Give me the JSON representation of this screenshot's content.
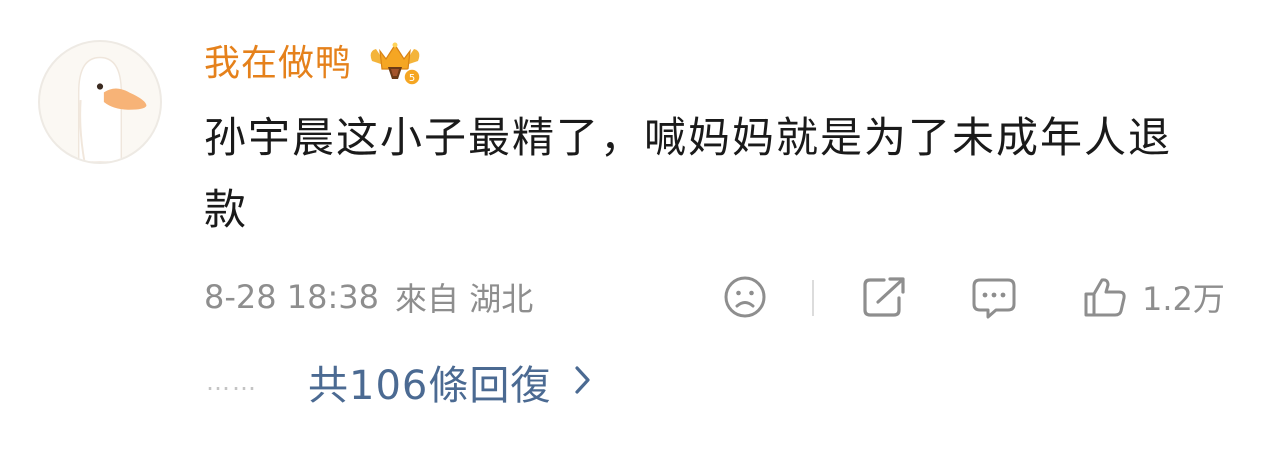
{
  "comment": {
    "username": "我在做鸭",
    "avatar_icon": "goose-avatar-icon",
    "badge_icon": "crown-badge-icon",
    "content": "孙宇晨这小子最精了，喊妈妈就是为了未成年人退款",
    "date": "8-28 18:38",
    "source": "來自 湖北",
    "actions": {
      "dislike_icon": "sad-face-icon",
      "share_icon": "share-icon",
      "comment_icon": "comment-icon",
      "like_icon": "thumbs-up-icon",
      "like_count": "1.2万"
    },
    "replies": {
      "dots": "……",
      "label": "共106條回復"
    }
  },
  "colors": {
    "username": "#e5811b",
    "link": "#4b6a92",
    "meta": "#8e8e8e",
    "text": "#1a1a1a"
  }
}
